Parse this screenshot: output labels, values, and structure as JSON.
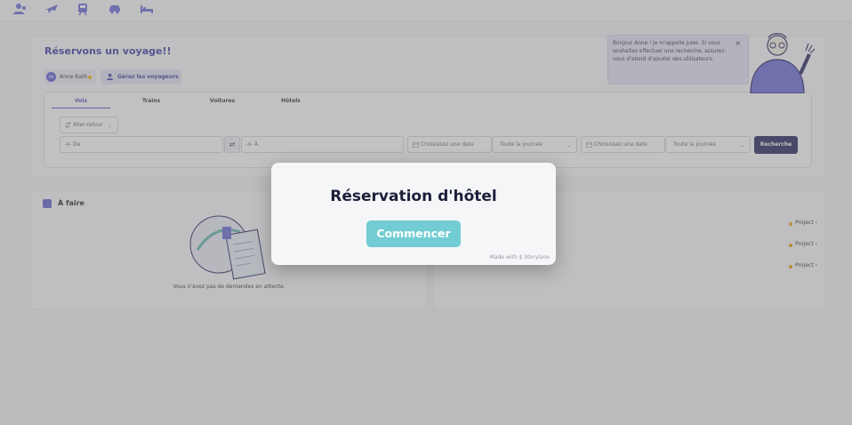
{
  "nav": {
    "icons": [
      "traveler-icon",
      "plane-icon",
      "train-icon",
      "car-icon",
      "hotel-icon"
    ]
  },
  "search": {
    "title": "Réservons un voyage!!",
    "traveler": {
      "initials": "AB",
      "name": "Anne Bath"
    },
    "manage_label": "Gérez les voyageurs",
    "tabs": [
      "Vols",
      "Trains",
      "Voitures",
      "Hôtels"
    ],
    "active_tab": "Vols",
    "trip_type": "Aller-retour",
    "from_placeholder": "De",
    "to_placeholder": "À",
    "depart_date_placeholder": "Choisissez une date",
    "depart_time": "Toute la journée",
    "return_date_placeholder": "Choisissez une date",
    "return_time": "Toute la journée",
    "search_label": "Recherche"
  },
  "assistant": {
    "message": "Bonjour Anne ! Je m'appelle Jules. Si vous souhaitez effectuer une recherche, assurez-vous d'abord d'ajouter des utilisateurs.",
    "close": "×"
  },
  "todo": {
    "title": "À faire",
    "empty_text": "Vous n'avez pas de demandes en attente."
  },
  "projects": {
    "items": [
      "Project",
      "Project",
      "Project"
    ],
    "chevron": "›"
  },
  "modal": {
    "title": "Réservation d'hôtel",
    "button": "Commencer",
    "made_with": "Made with",
    "brand": "Storylane"
  },
  "colors": {
    "accent": "#5050c0",
    "dark_button": "#23235e",
    "modal_button": "#71cdd3",
    "project_dot": "#e8a000"
  }
}
